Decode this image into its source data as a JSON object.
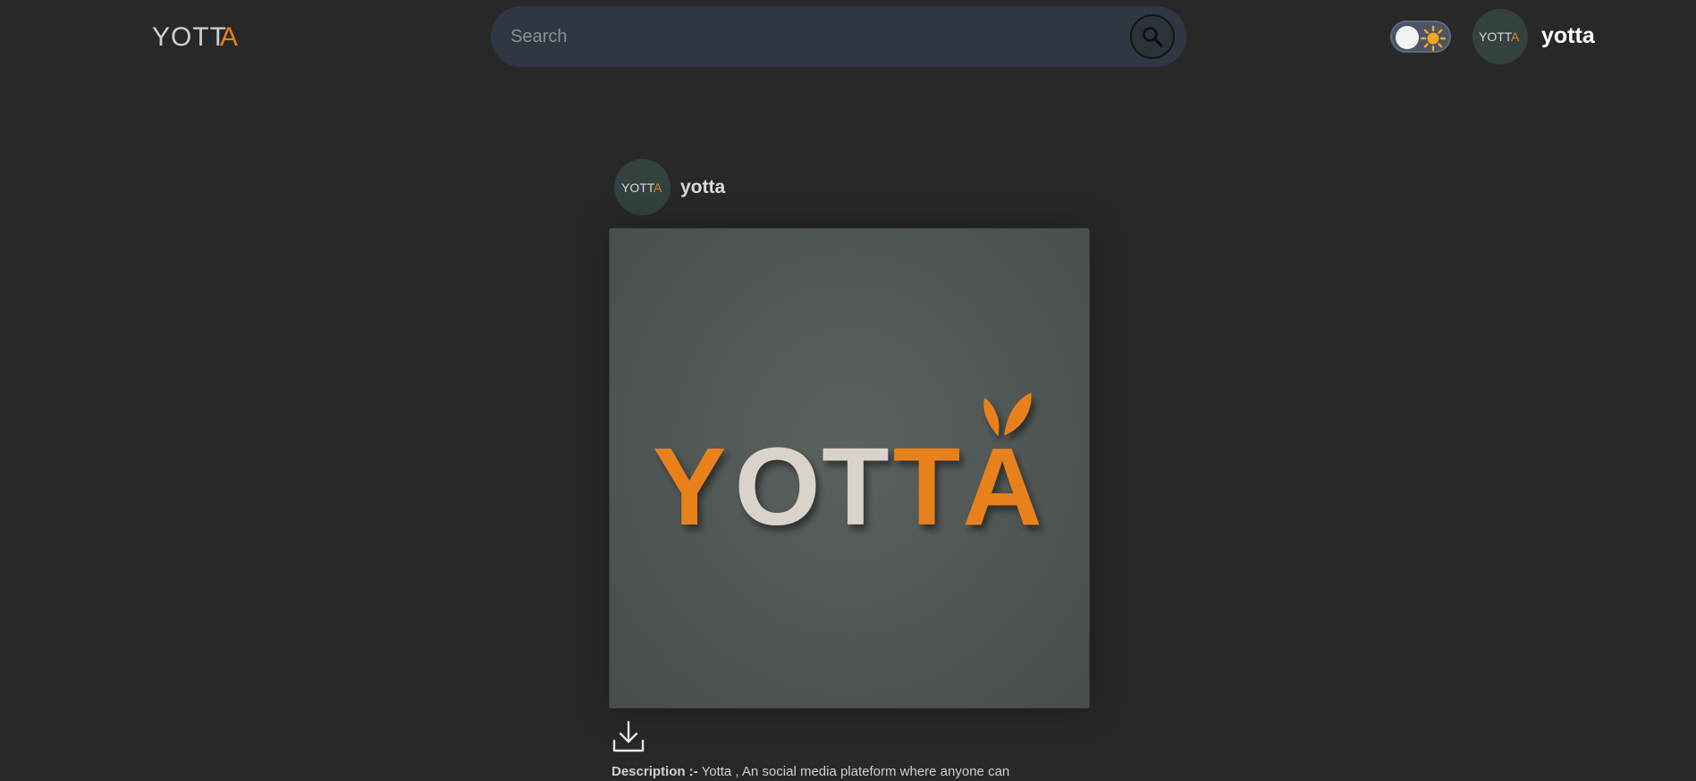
{
  "header": {
    "logo": {
      "text_dark": "YOTT",
      "text_accent": "A"
    },
    "search": {
      "placeholder": "Search"
    },
    "theme_toggle": {
      "state": "light",
      "icon": "sun-icon"
    },
    "user": {
      "name": "yotta",
      "avatar_text_dark": "YOTT",
      "avatar_text_accent": "A"
    }
  },
  "post": {
    "author": "yotta",
    "avatar_text_dark": "YOTT",
    "avatar_text_accent": "A",
    "image": {
      "logo_letters": [
        "Y",
        "O",
        "T",
        "T",
        "A"
      ],
      "colors": {
        "orange": "#e8811c",
        "cream": "#d9d3ca",
        "background": "#525957"
      }
    },
    "download_icon": "download-icon",
    "description_label": "Description :-",
    "description_text": "Yotta , An social media plateform where anyone can"
  },
  "colors": {
    "page_bg": "#282828",
    "search_bg": "#303742",
    "accent": "#e8811c"
  }
}
